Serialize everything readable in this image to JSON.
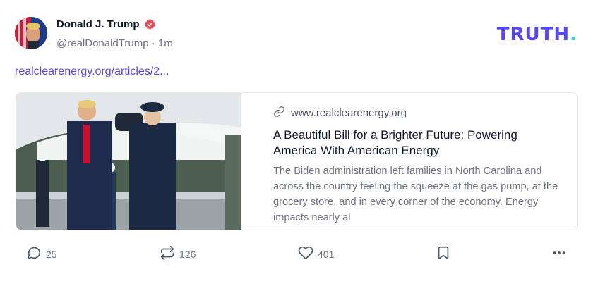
{
  "post": {
    "author": {
      "display_name": "Donald J. Trump",
      "handle": "@realDonaldTrump",
      "separator": "·",
      "time": "1m",
      "verified": true
    },
    "brand_logo": {
      "text": "TRUTH",
      "dot": "."
    },
    "link_text": "realclearenergy.org/articles/2...",
    "card": {
      "domain": "www.realclearenergy.org",
      "title": "A Beautiful Bill for a Brighter Future: Powering America With American Energy",
      "description": "The Biden administration left families in North Carolina and across the country feeling the squeeze at the gas pump, at the grocery store, and in every corner of the economy. Energy impacts nearly al"
    },
    "actions": {
      "replies": "25",
      "reposts": "126",
      "likes": "401"
    }
  },
  "colors": {
    "brand": "#5448ee",
    "brand_dot": "#32d3c9",
    "verified_badge": "#e54e5a",
    "muted_text": "#6b7280"
  },
  "icons": [
    "verified-badge-icon",
    "link-icon",
    "reply-icon",
    "repost-icon",
    "heart-icon",
    "bookmark-icon",
    "more-icon"
  ]
}
